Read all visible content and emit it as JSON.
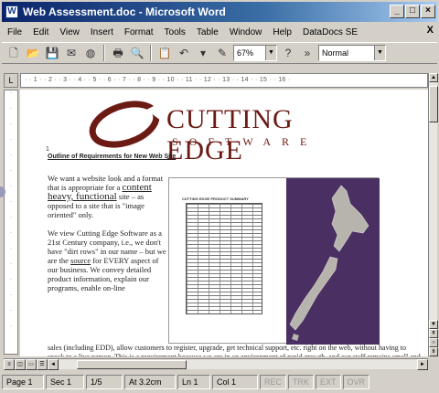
{
  "window": {
    "title": "Web Assessment.doc - Microsoft Word",
    "controls": {
      "minimize": "_",
      "maximize": "□",
      "close": "×"
    }
  },
  "menu": {
    "items": [
      "File",
      "Edit",
      "View",
      "Insert",
      "Format",
      "Tools",
      "Table",
      "Window",
      "Help",
      "DataDocs SE"
    ],
    "close_doc": "X"
  },
  "toolbar": {
    "zoom": "67%",
    "style": "Normal"
  },
  "ruler": {
    "text": "· · 1 · · 2 · · 3 · · 4 · · 5 · · 6 · · 7 · · 8 · · 9 · · 10 · · 11 · · 12 · · 13 · · 14 · · 15 · · 16 ·"
  },
  "document": {
    "logo_name": "CUTTING EDGE",
    "logo_sub": "SOFTWARE",
    "paragraph_mark": "1",
    "heading": "Outline of Requirements for New Web Site",
    "para1_pre": "We want a website look and a format that is appropriate for a",
    "para1_link": "content heavy, functional",
    "para1_post": "site – as opposed to a site that is \"image oriented\" only.",
    "para2_pre": "We view Cutting Edge Software as a 21st Century company, i.e., we don't have \"dirt rows\" in our name – but we are the",
    "para2_link": "source",
    "para2_post": "for EVERY aspect of our business. We convey detailed product information, explain our programs, enable on-line",
    "bottom": "sales (including EDD), allow customers to register, upgrade, get technical support, etc. right on the web, without having to speak to a live person. This is a requirement because we are in an environment of rapid growth, and our staff remains small and the site is our key source..."
  },
  "image": {
    "table_title": "CUTTING EDGE PRODUCT SUMMARY"
  },
  "status": {
    "page": "Page 1",
    "sec": "Sec 1",
    "pages": "1/5",
    "at": "At 3.2cm",
    "ln": "Ln 1",
    "col": "Col 1",
    "rec": "REC",
    "trk": "TRK",
    "ext": "EXT",
    "ovr": "OVR"
  }
}
